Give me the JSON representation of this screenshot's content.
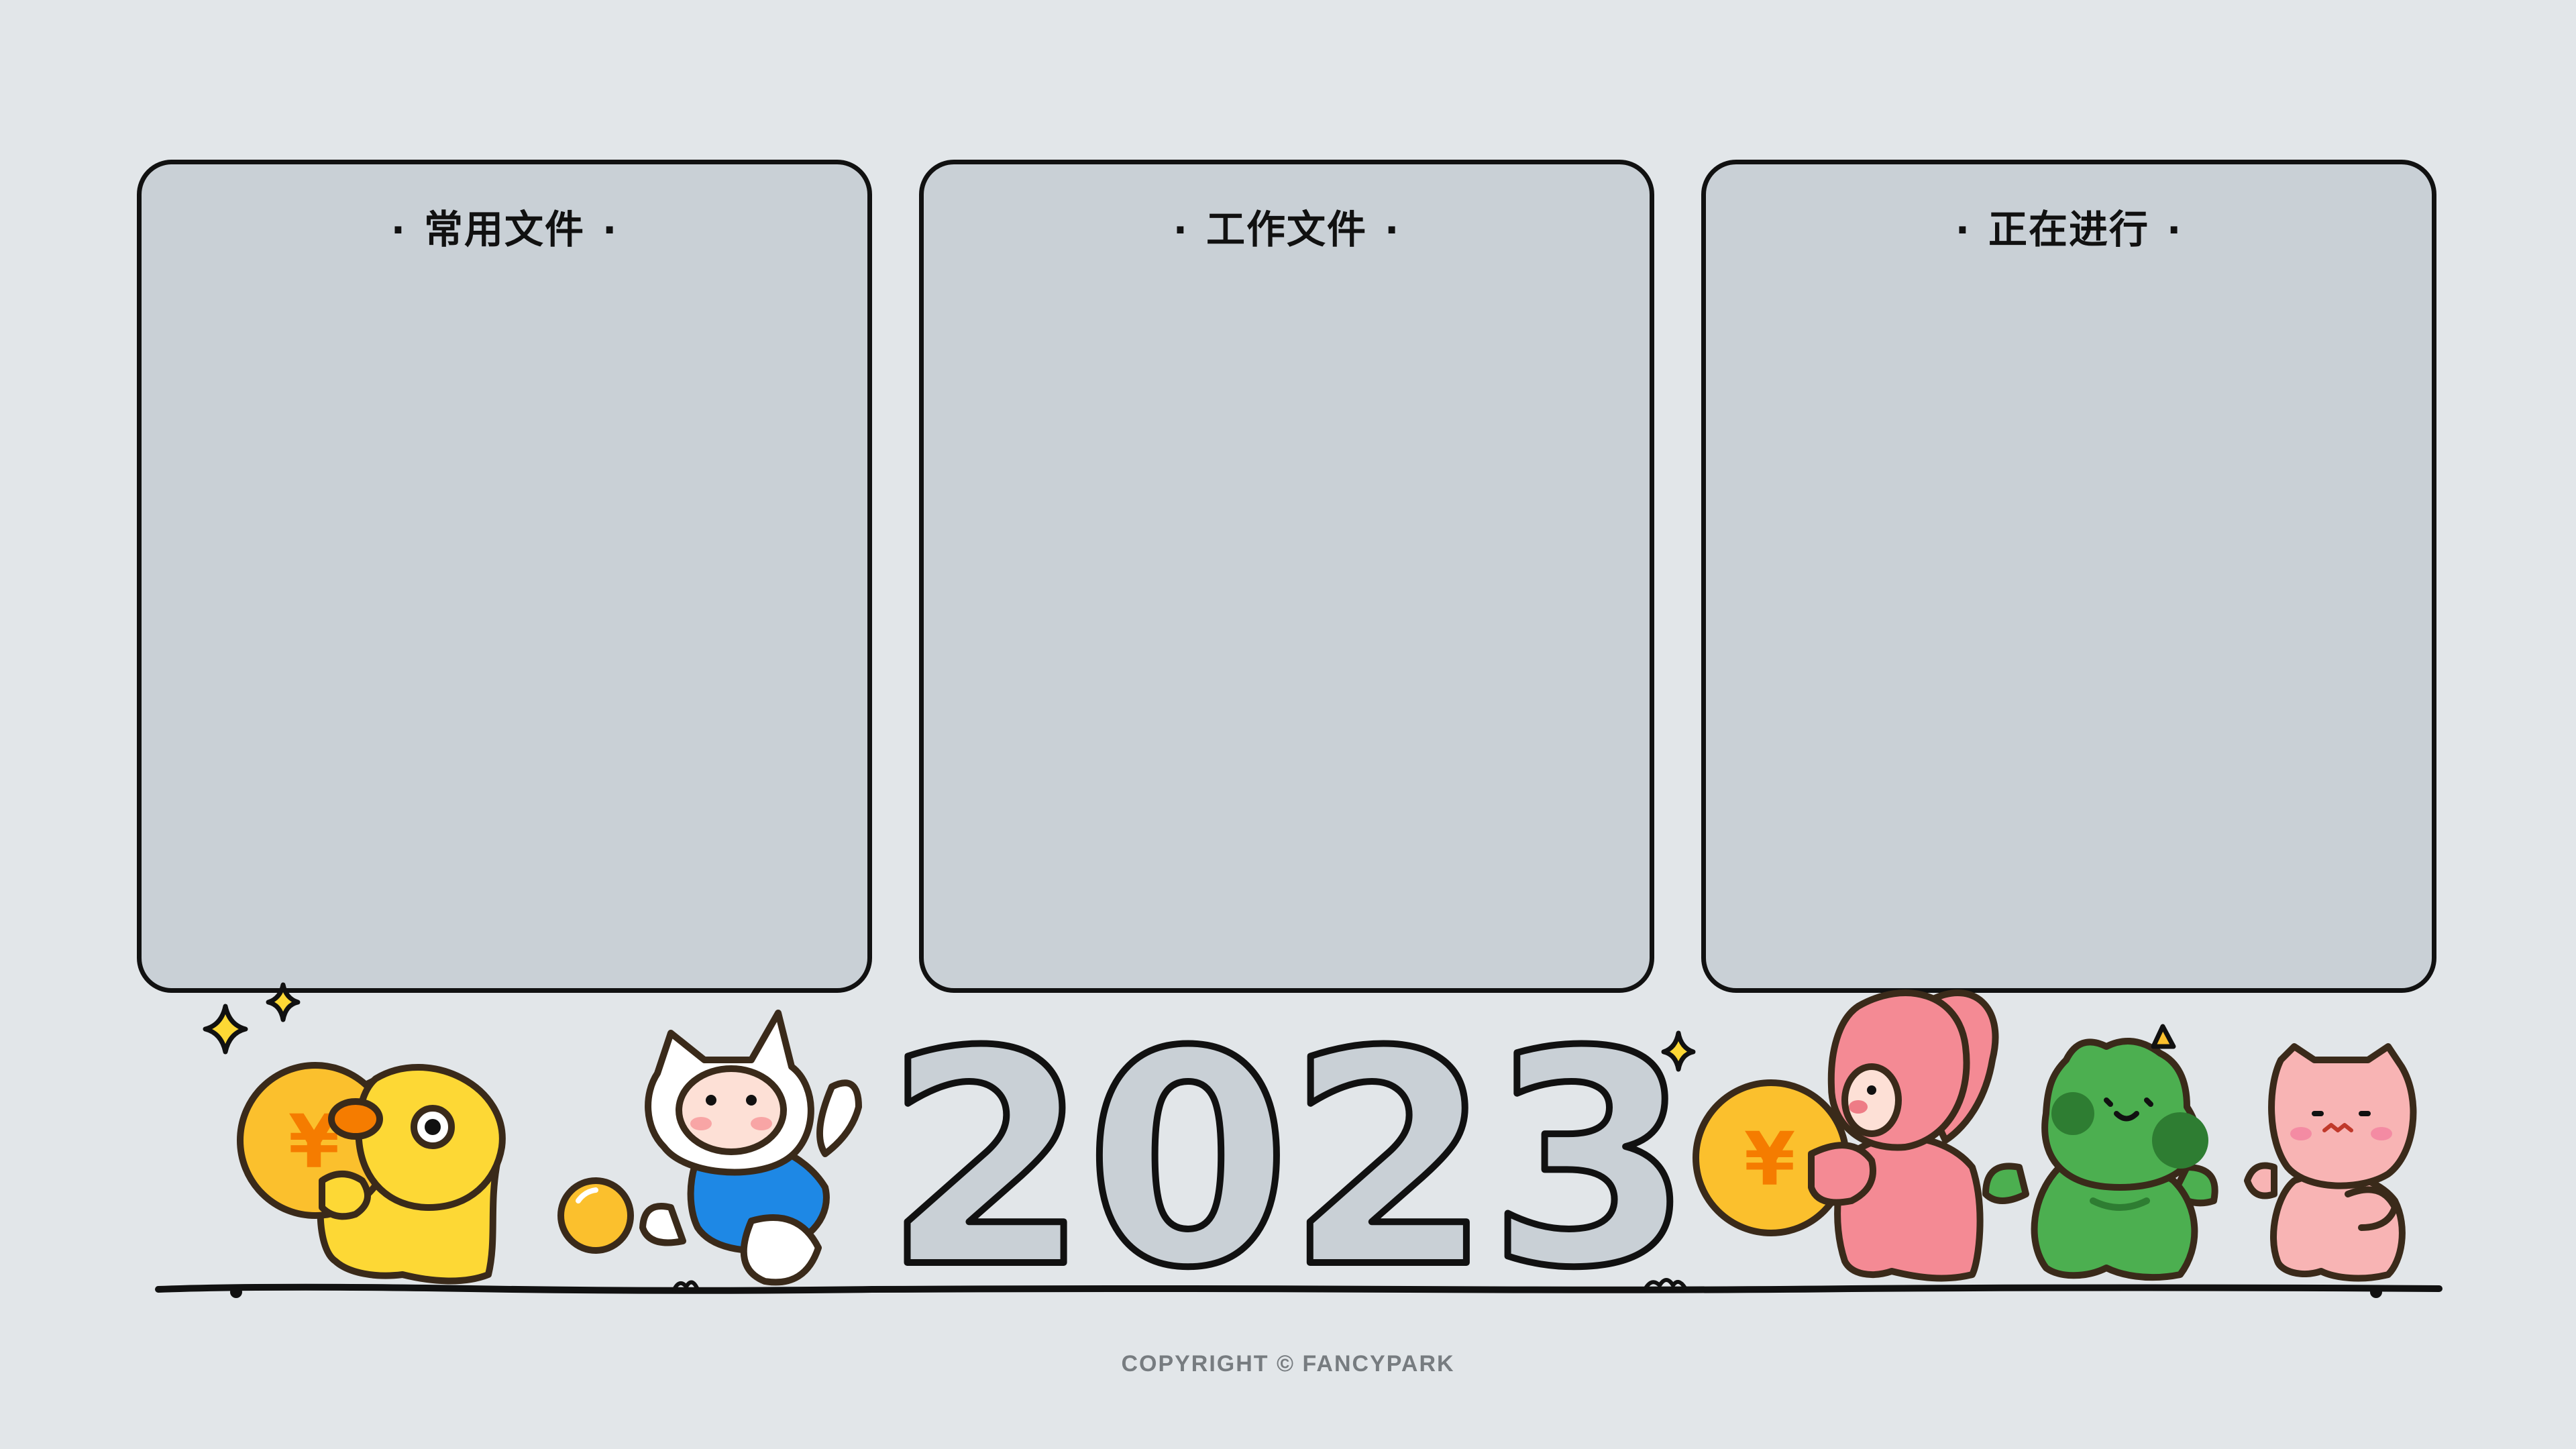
{
  "panels": [
    {
      "title": "常用文件"
    },
    {
      "title": "工作文件"
    },
    {
      "title": "正在进行"
    }
  ],
  "title_dot": "·",
  "year": "2023",
  "coin_symbol": "¥",
  "copyright": "COPYRIGHT © FANCYPARK",
  "colors": {
    "background": "#e2e6e9",
    "panel_fill": "#c9d0d6",
    "outline": "#111111",
    "year_fill": "#c9d0d6",
    "duck": "#fdd835",
    "coin": "#fbc02d",
    "coin_symbol": "#f57c00",
    "rabbit": "#f48a94",
    "frog": "#4caf50",
    "pig": "#f8b4b4",
    "cat_shirt": "#1e88e5"
  },
  "icons": [
    "sparkle-icon",
    "yen-coin-icon"
  ]
}
